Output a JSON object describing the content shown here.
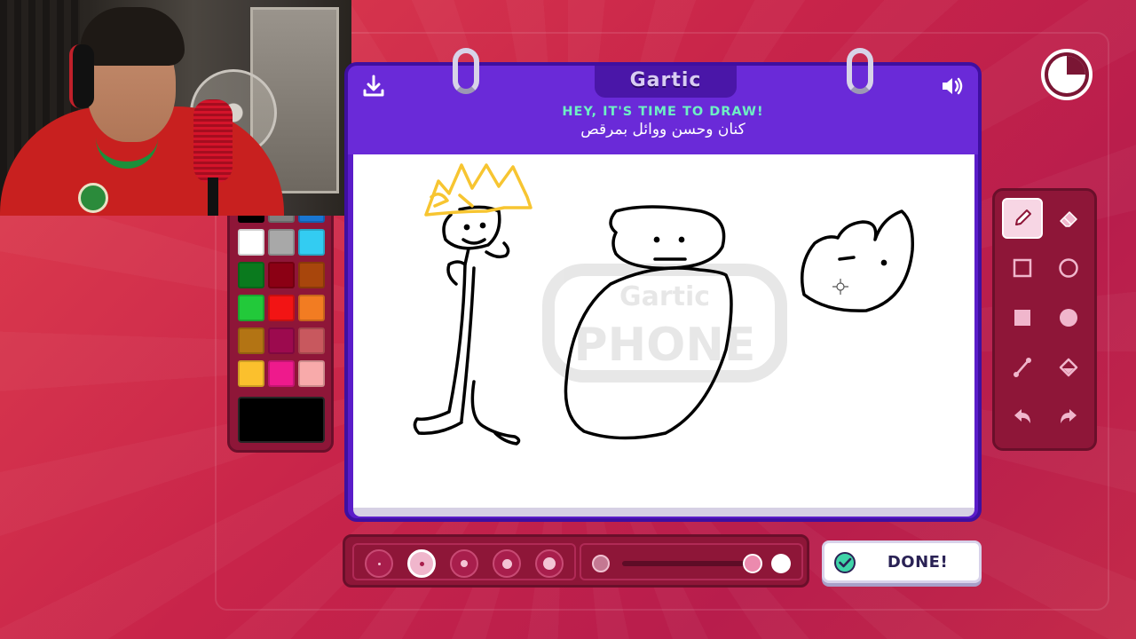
{
  "header": {
    "logo": "Gartic",
    "title": "HEY, IT'S TIME TO DRAW!",
    "prompt": "كنان وحسن ووائل بمرقص"
  },
  "icons": {
    "download": "download-icon",
    "sound": "speaker-icon",
    "timer": "timer-icon",
    "done": "check-circle-icon"
  },
  "palette": {
    "colors": [
      "#000000",
      "#808080",
      "#1976d2",
      "#ffffff",
      "#a8a8a8",
      "#33ccf2",
      "#0a7a1e",
      "#8b0014",
      "#a8460c",
      "#22c93a",
      "#f21414",
      "#f27c22",
      "#b37414",
      "#9c0a4e",
      "#c8585e",
      "#fbc02d",
      "#ee1a8c",
      "#f8aaaa"
    ],
    "current_color": "#000000"
  },
  "tools": [
    {
      "name": "pencil",
      "icon": "pencil-icon",
      "selected": true
    },
    {
      "name": "eraser",
      "icon": "eraser-icon",
      "selected": false
    },
    {
      "name": "rectangle-outline",
      "icon": "square-outline-icon",
      "selected": false
    },
    {
      "name": "ellipse-outline",
      "icon": "circle-outline-icon",
      "selected": false
    },
    {
      "name": "rectangle-fill",
      "icon": "square-fill-icon",
      "selected": false
    },
    {
      "name": "ellipse-fill",
      "icon": "circle-fill-icon",
      "selected": false
    },
    {
      "name": "line",
      "icon": "line-icon",
      "selected": false
    },
    {
      "name": "fill-bucket",
      "icon": "bucket-icon",
      "selected": false
    },
    {
      "name": "undo",
      "icon": "undo-icon",
      "selected": false
    },
    {
      "name": "redo",
      "icon": "redo-icon",
      "selected": false
    }
  ],
  "brush_sizes": {
    "count": 5,
    "selected_index": 1
  },
  "opacity": {
    "value": 1.0
  },
  "done_button": {
    "label": "DONE!"
  },
  "watermark": {
    "line1": "Gartic",
    "line2": "PHONE"
  }
}
